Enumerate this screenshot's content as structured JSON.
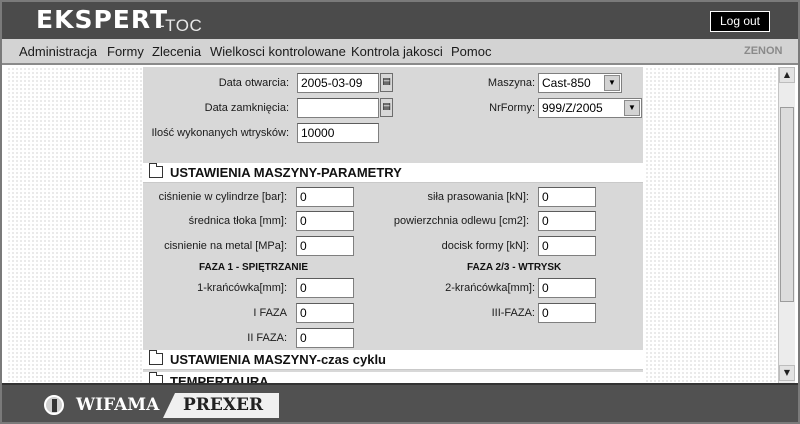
{
  "header": {
    "brand": "EKSPERT",
    "brand_sub": "-TOC",
    "logout_label": "Log out"
  },
  "menu": {
    "items": [
      "Administracja",
      "Formy",
      "Zlecenia",
      "Wielkosci kontrolowane",
      "Kontrola jakosci",
      "Pomoc"
    ],
    "user": "ZENON"
  },
  "form": {
    "data_otwarcia_label": "Data otwarcia:",
    "data_otwarcia_value": "2005-03-09",
    "data_zamkniecia_label": "Data zamknięcia:",
    "data_zamkniecia_value": "",
    "ilosc_label": "Ilość wykonanych wtrysków:",
    "ilosc_value": "10000",
    "maszyna_label": "Maszyna:",
    "maszyna_value": "Cast-850",
    "nrformy_label": "NrFormy:",
    "nrformy_value": "999/Z/2005"
  },
  "sections": {
    "parametry_title": "USTAWIENIA MASZYNY-PARAMETRY",
    "czas_title": "USTAWIENIA MASZYNY-czas cyklu",
    "temp_title": "TEMPERTAURA"
  },
  "params": {
    "cisnienie_cyl_label": "ciśnienie w cylindrze [bar]:",
    "cisnienie_cyl_value": "0",
    "srednica_label": "średnica tłoka [mm]:",
    "srednica_value": "0",
    "cisnienie_metal_label": "cisnienie na metal [MPa]:",
    "cisnienie_metal_value": "0",
    "sila_label": "siła prasowania [kN]:",
    "sila_value": "0",
    "powierzchnia_label": "powierzchnia odlewu [cm2]:",
    "powierzchnia_value": "0",
    "docisk_label": "docisk formy [kN]:",
    "docisk_value": "0",
    "faza1_title": "FAZA 1 - SPIĘTRZANIE",
    "faza23_title": "FAZA 2/3 - WTRYSK",
    "k1_label": "1-krańcówka[mm]:",
    "k1_value": "0",
    "ifaza_label": "I FAZA",
    "ifaza_value": "0",
    "iifaza_label": "II FAZA:",
    "iifaza_value": "0",
    "k2_label": "2-krańcówka[mm]:",
    "k2_value": "0",
    "iiifaza_label": "III-FAZA:",
    "iiifaza_value": "0"
  },
  "footer": {
    "logo_left": "WIFAMA",
    "logo_right": "PREXER"
  }
}
